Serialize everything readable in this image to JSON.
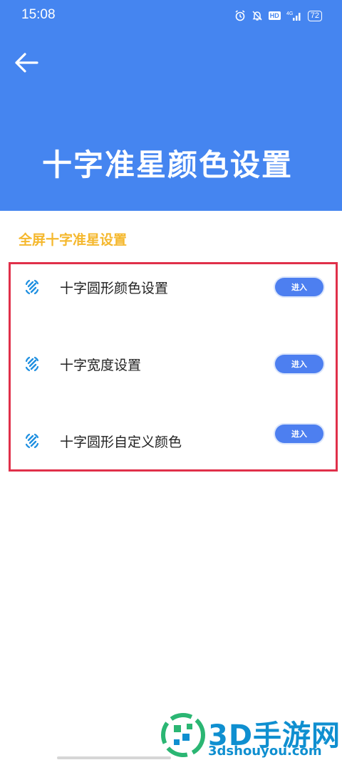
{
  "status_bar": {
    "time": "15:08",
    "hd_label": "HD",
    "network_label": "4G",
    "battery_level": "72",
    "icons": [
      "alarm-icon",
      "mute-bell-icon",
      "hd-icon",
      "signal-icon",
      "battery-icon"
    ]
  },
  "header": {
    "title": "十字准星颜色设置",
    "back_icon": "arrow-left-icon",
    "background_color": "#4585f0"
  },
  "section": {
    "title": "全屏十字准星设置",
    "title_color": "#f5b82e"
  },
  "settings_items": [
    {
      "label": "十字圆形颜色设置",
      "button_label": "进入",
      "icon": "crosshair-icon"
    },
    {
      "label": "十字宽度设置",
      "button_label": "进入",
      "icon": "crosshair-icon"
    },
    {
      "label": "十字圆形自定义颜色",
      "button_label": "进入",
      "icon": "crosshair-icon"
    }
  ],
  "highlight_color": "#e0304a",
  "watermark": {
    "name": "3D手游网",
    "url": "3dshouyou.com"
  }
}
